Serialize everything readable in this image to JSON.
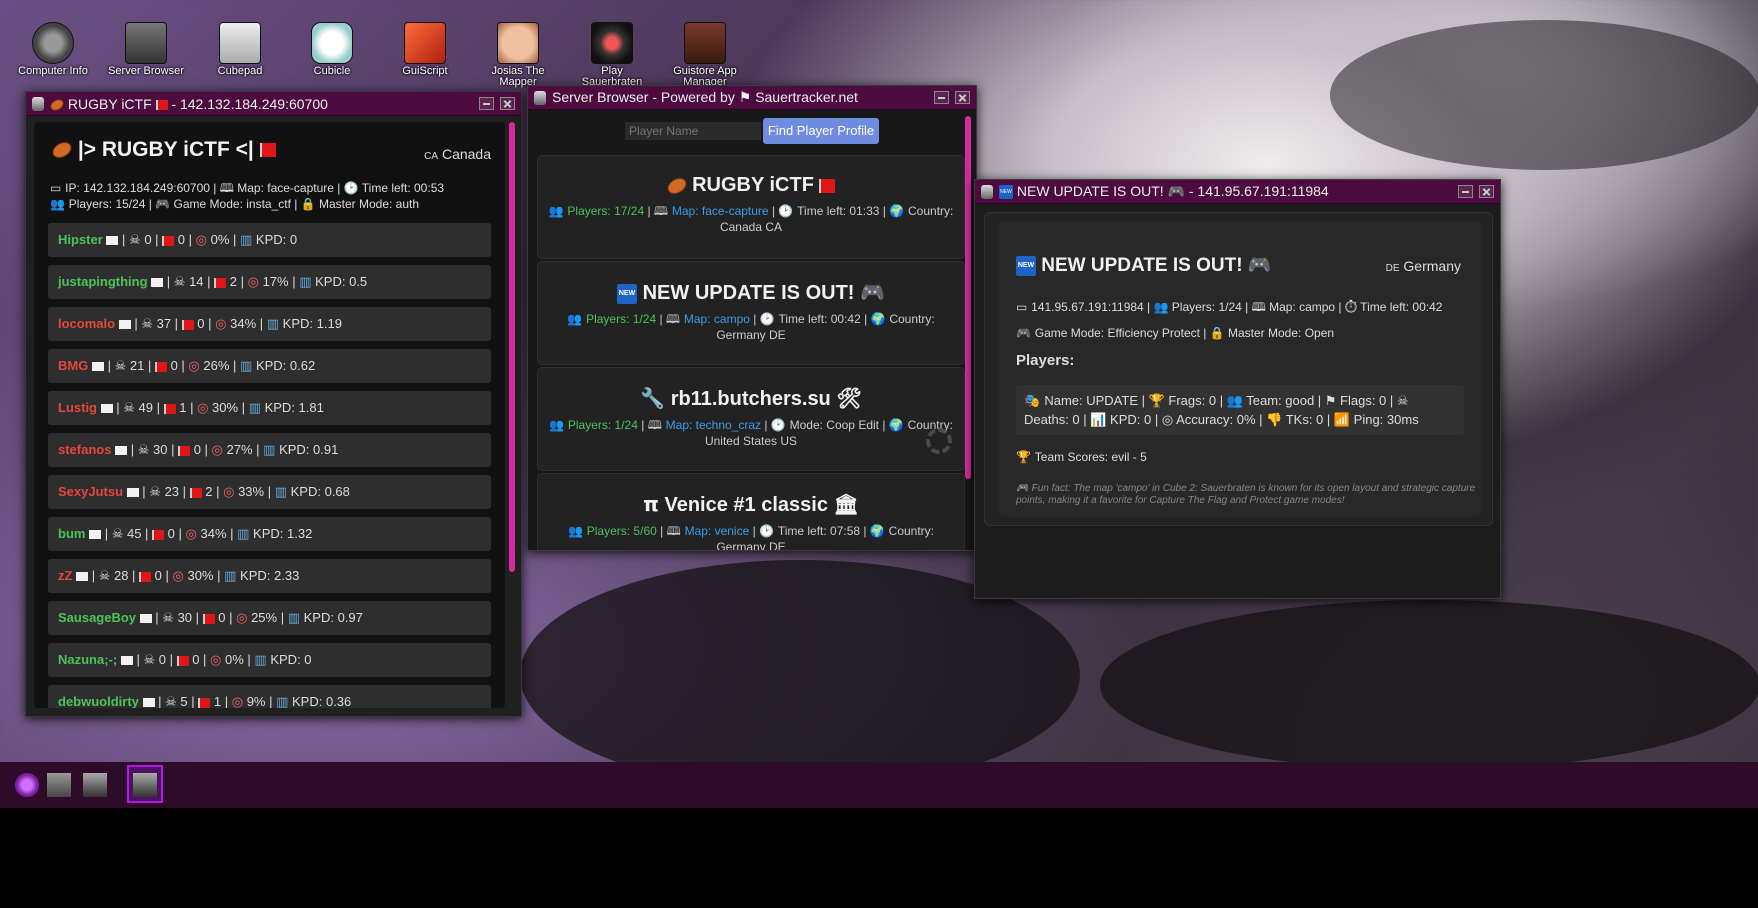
{
  "desktop": {
    "icons": [
      {
        "label": "Computer Info"
      },
      {
        "label": "Server Browser"
      },
      {
        "label": "Cubepad"
      },
      {
        "label": "Cubicle"
      },
      {
        "label": "GuiScript"
      },
      {
        "label": "Josias The Mapper"
      },
      {
        "label": "Play Sauerbraten"
      },
      {
        "label": "Guistore App Manager"
      }
    ]
  },
  "rugby_window": {
    "title_name": "RUGBY iCTF",
    "title_address": "- 142.132.184.249:60700",
    "server_name": "|> RUGBY iCTF <|",
    "country_code": "CA",
    "country": "Canada",
    "info_line1": "IP: 142.132.184.249:60700 | 🕮 Map: face-capture | 🕑 Time left: 00:53",
    "info_line2": "Players: 15/24 | 🎮 Game Mode: insta_ctf | 🔒 Master Mode: auth",
    "players": [
      {
        "name": "Hipster",
        "color": "#4cc25a",
        "deaths": "0",
        "flags": "0",
        "acc": "0%",
        "kpd": "KPD: 0"
      },
      {
        "name": "justapingthing",
        "color": "#4cc25a",
        "deaths": "14",
        "flags": "2",
        "acc": "17%",
        "kpd": "KPD: 0.5"
      },
      {
        "name": "locomalo",
        "color": "#e5473b",
        "deaths": "37",
        "flags": "0",
        "acc": "34%",
        "kpd": "KPD: 1.19"
      },
      {
        "name": "BMG",
        "color": "#e5473b",
        "deaths": "21",
        "flags": "0",
        "acc": "26%",
        "kpd": "KPD: 0.62"
      },
      {
        "name": "Lustig",
        "color": "#e5473b",
        "deaths": "49",
        "flags": "1",
        "acc": "30%",
        "kpd": "KPD: 1.81"
      },
      {
        "name": "stefanos",
        "color": "#e5473b",
        "deaths": "30",
        "flags": "0",
        "acc": "27%",
        "kpd": "KPD: 0.91"
      },
      {
        "name": "SexyJutsu",
        "color": "#e5473b",
        "deaths": "23",
        "flags": "2",
        "acc": "33%",
        "kpd": "KPD: 0.68"
      },
      {
        "name": "bum",
        "color": "#4cc25a",
        "deaths": "45",
        "flags": "0",
        "acc": "34%",
        "kpd": "KPD: 1.32"
      },
      {
        "name": "zZ",
        "color": "#e5473b",
        "deaths": "28",
        "flags": "0",
        "acc": "30%",
        "kpd": "KPD: 2.33"
      },
      {
        "name": "SausageBoy",
        "color": "#4cc25a",
        "deaths": "30",
        "flags": "0",
        "acc": "25%",
        "kpd": "KPD: 0.97"
      },
      {
        "name": "Nazuna;-;",
        "color": "#4cc25a",
        "deaths": "0",
        "flags": "0",
        "acc": "0%",
        "kpd": "KPD: 0"
      },
      {
        "name": "debwuoldirty",
        "color": "#4cc25a",
        "deaths": "5",
        "flags": "1",
        "acc": "9%",
        "kpd": "KPD: 0.36"
      }
    ]
  },
  "browser_window": {
    "title": "Server Browser - Powered by",
    "title_link": "Sauertracker.net",
    "search_placeholder": "Player Name",
    "find_button": "Find Player Profile",
    "servers": [
      {
        "name": "RUGBY iCTF",
        "players": "Players: 17/24",
        "map": "Map: face-capture",
        "middle": "Time left: 01:33",
        "country": "Country:",
        "country_line2": "Canada CA"
      },
      {
        "name": "NEW UPDATE IS OUT!",
        "players": "Players: 1/24",
        "map": "Map: campo",
        "middle": "Time left: 00:42",
        "country": "Country:",
        "country_line2": "Germany DE"
      },
      {
        "name": "rb11.butchers.su",
        "players": "Players: 1/24",
        "map": "Map: techno_craz",
        "middle": "Mode: Coop Edit",
        "country": "Country:",
        "country_line2": "United States US"
      },
      {
        "name": "Venice #1 classic",
        "players": "Players: 5/60",
        "map": "Map: venice",
        "middle": "Time left: 07:58",
        "country": "Country:",
        "country_line2": "Germany DE"
      }
    ]
  },
  "update_window": {
    "title_name": "NEW UPDATE IS OUT!",
    "title_address": "- 141.95.67.191:11984",
    "server_name": "NEW UPDATE IS OUT!",
    "country_code": "DE",
    "country": "Germany",
    "info_line1": "141.95.67.191:11984 | 👥 Players: 1/24 | 🕮 Map: campo | ⏱ Time left: 00:42",
    "info_line2": "Game Mode: Efficiency Protect | 🔒 Master Mode: Open",
    "players_heading": "Players:",
    "player_line1": "Name: UPDATE | 🏆 Frags: 0 | 👥 Team: good | ⚑ Flags: 0 | ☠",
    "player_line2": "Deaths: 0 | 📊 KPD: 0 | ◎ Accuracy: 0% | 👎 TKs: 0 | 📶 Ping: 30ms",
    "team_scores": "Team Scores: evil - 5",
    "fun_fact": "Fun fact: The map 'campo' in Cube 2: Sauerbraten is known for its open layout and strategic capture points, making it a favorite for Capture The Flag and Protect game modes!"
  },
  "colors": {
    "titlebar": "#4e0b3f",
    "accent_scroll": "#d42a9d",
    "button": "#6f8ce0",
    "team_good": "#4cc25a",
    "team_evil": "#e5473b",
    "link": "#3d9be9"
  }
}
